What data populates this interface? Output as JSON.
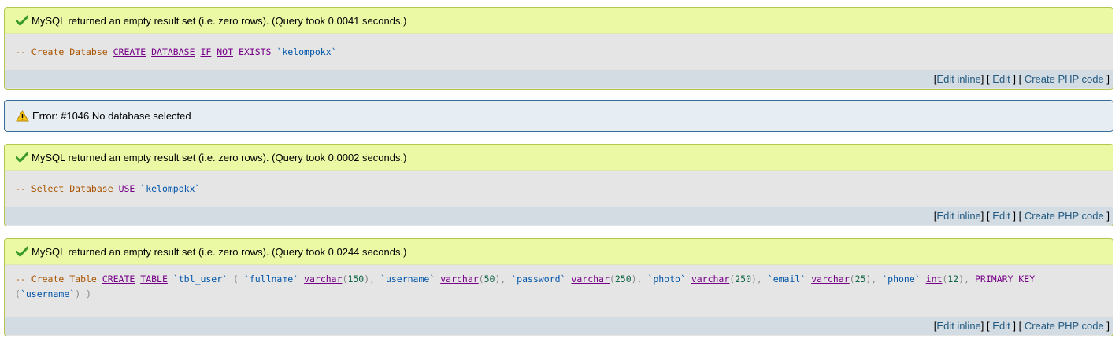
{
  "results": [
    {
      "message": "MySQL returned an empty result set (i.e. zero rows). (Query took 0.0041 seconds.)",
      "sql": [
        {
          "t": "-- Create Databse ",
          "c": "comment"
        },
        {
          "t": "CREATE",
          "c": "kw"
        },
        {
          "t": " ",
          "c": "plain"
        },
        {
          "t": "DATABASE",
          "c": "kw"
        },
        {
          "t": " ",
          "c": "plain"
        },
        {
          "t": "IF",
          "c": "kw"
        },
        {
          "t": " ",
          "c": "plain"
        },
        {
          "t": "NOT",
          "c": "kw"
        },
        {
          "t": " EXISTS ",
          "c": "kwplain"
        },
        {
          "t": "`kelompokx`",
          "c": "str"
        }
      ]
    },
    {
      "message": "MySQL returned an empty result set (i.e. zero rows). (Query took 0.0002 seconds.)",
      "sql": [
        {
          "t": "-- Select Database ",
          "c": "comment"
        },
        {
          "t": "USE ",
          "c": "kwplain"
        },
        {
          "t": "`kelompokx`",
          "c": "str"
        }
      ]
    },
    {
      "message": "MySQL returned an empty result set (i.e. zero rows). (Query took 0.0244 seconds.)",
      "sql": [
        {
          "t": "-- Create Table ",
          "c": "comment"
        },
        {
          "t": "CREATE",
          "c": "kw"
        },
        {
          "t": " ",
          "c": "plain"
        },
        {
          "t": "TABLE",
          "c": "kw"
        },
        {
          "t": " ",
          "c": "plain"
        },
        {
          "t": "`tbl_user`",
          "c": "str"
        },
        {
          "t": " ( ",
          "c": "punc"
        },
        {
          "t": "`fullname`",
          "c": "str"
        },
        {
          "t": " ",
          "c": "plain"
        },
        {
          "t": "varchar",
          "c": "kw"
        },
        {
          "t": "(",
          "c": "punc"
        },
        {
          "t": "150",
          "c": "num"
        },
        {
          "t": "), ",
          "c": "punc"
        },
        {
          "t": "`username`",
          "c": "str"
        },
        {
          "t": " ",
          "c": "plain"
        },
        {
          "t": "varchar",
          "c": "kw"
        },
        {
          "t": "(",
          "c": "punc"
        },
        {
          "t": "50",
          "c": "num"
        },
        {
          "t": "), ",
          "c": "punc"
        },
        {
          "t": "`password`",
          "c": "str"
        },
        {
          "t": " ",
          "c": "plain"
        },
        {
          "t": "varchar",
          "c": "kw"
        },
        {
          "t": "(",
          "c": "punc"
        },
        {
          "t": "250",
          "c": "num"
        },
        {
          "t": "), ",
          "c": "punc"
        },
        {
          "t": "`photo`",
          "c": "str"
        },
        {
          "t": " ",
          "c": "plain"
        },
        {
          "t": "varchar",
          "c": "kw"
        },
        {
          "t": "(",
          "c": "punc"
        },
        {
          "t": "250",
          "c": "num"
        },
        {
          "t": "), ",
          "c": "punc"
        },
        {
          "t": "`email`",
          "c": "str"
        },
        {
          "t": " ",
          "c": "plain"
        },
        {
          "t": "varchar",
          "c": "kw"
        },
        {
          "t": "(",
          "c": "punc"
        },
        {
          "t": "25",
          "c": "num"
        },
        {
          "t": "), ",
          "c": "punc"
        },
        {
          "t": "`phone`",
          "c": "str"
        },
        {
          "t": " ",
          "c": "plain"
        },
        {
          "t": "int",
          "c": "kw"
        },
        {
          "t": "(",
          "c": "punc"
        },
        {
          "t": "12",
          "c": "num"
        },
        {
          "t": "), ",
          "c": "punc"
        },
        {
          "t": "PRIMARY KEY ",
          "c": "kwplain"
        },
        {
          "t": "(",
          "c": "punc"
        },
        {
          "t": "`username`",
          "c": "str"
        },
        {
          "t": ") )",
          "c": "punc"
        }
      ]
    }
  ],
  "error": {
    "message": "Error: #1046 No database selected"
  },
  "toolbar": {
    "open_bracket": "[",
    "close_bracket": "]",
    "edit_inline": "Edit inline",
    "edit": "Edit",
    "create_php": "Create PHP code"
  },
  "colors": {
    "success_bg": "#ebf8a4",
    "error_bg": "#e7eef3",
    "link": "#235a81",
    "sql_bg": "#e5e5e5",
    "toolbar_bg": "#d3dce3"
  },
  "icons": {
    "success": "check-icon",
    "error": "warning-icon"
  }
}
